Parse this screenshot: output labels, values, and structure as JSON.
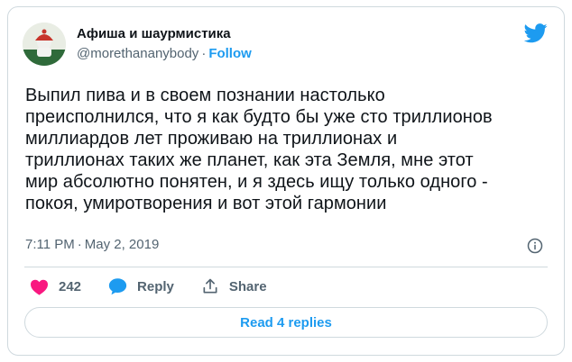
{
  "author": {
    "display_name": "Афиша и шаурмистика",
    "handle": "@morethananybody",
    "separator": "·",
    "follow_label": "Follow"
  },
  "tweet": {
    "text": "Выпил пива и в своем познании настолько\nпреисполнился, что я как будто бы уже сто триллионов\nмиллиардов лет проживаю на триллионах и\nтриллионах таких же планет, как эта Земля, мне этот\nмир абсолютно понятен, и я здесь ищу только одного -\nпокоя, умиротворения и вот этой гармонии",
    "time": "7:11 PM",
    "separator": "·",
    "date": "May 2, 2019"
  },
  "actions": {
    "like_count": "242",
    "reply_label": "Reply",
    "share_label": "Share"
  },
  "read_replies_label": "Read 4 replies",
  "icons": {
    "bird": "twitter-bird-icon",
    "info": "info-icon",
    "heart": "heart-icon",
    "reply": "reply-bubble-icon",
    "share": "share-icon"
  },
  "colors": {
    "accent": "#1d9bf0",
    "like": "#f91880",
    "text": "#0f1419",
    "secondary": "#536471",
    "border": "#cfd9de"
  }
}
